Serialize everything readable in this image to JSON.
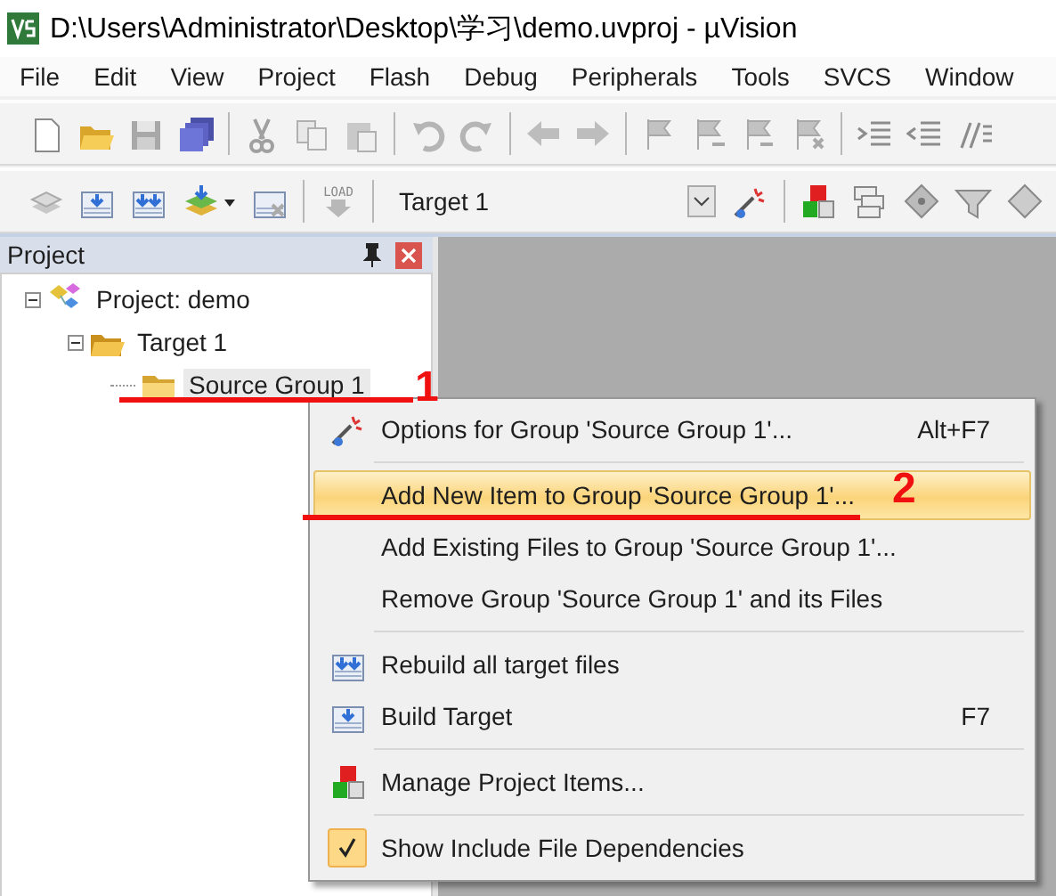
{
  "window": {
    "title": "D:\\Users\\Administrator\\Desktop\\学习\\demo.uvproj - µVision"
  },
  "menu_bar": [
    "File",
    "Edit",
    "View",
    "Project",
    "Flash",
    "Debug",
    "Peripherals",
    "Tools",
    "SVCS",
    "Window"
  ],
  "build_toolbar": {
    "load_label": "LOAD",
    "target": "Target 1"
  },
  "project_panel": {
    "title": "Project",
    "tree": [
      {
        "label": "Project: demo",
        "expanded": true,
        "selected": false,
        "children": [
          {
            "label": "Target 1",
            "expanded": true,
            "selected": false,
            "children": [
              {
                "label": "Source Group 1",
                "selected": true
              }
            ]
          }
        ]
      }
    ]
  },
  "context_menu": [
    {
      "kind": "item",
      "label": "Options for Group 'Source Group 1'...",
      "shortcut": "Alt+F7",
      "selected": false,
      "checked": false
    },
    {
      "kind": "separator"
    },
    {
      "kind": "item",
      "label": "Add New  Item to Group 'Source Group 1'...",
      "selected": true,
      "checked": false
    },
    {
      "kind": "item",
      "label": "Add Existing Files to Group 'Source Group 1'...",
      "selected": false,
      "checked": false
    },
    {
      "kind": "item",
      "label": "Remove Group 'Source Group 1' and its Files",
      "selected": false,
      "checked": false
    },
    {
      "kind": "separator"
    },
    {
      "kind": "item",
      "label": "Rebuild all target files",
      "selected": false,
      "checked": false
    },
    {
      "kind": "item",
      "label": "Build Target",
      "shortcut": "F7",
      "selected": false,
      "checked": false
    },
    {
      "kind": "separator"
    },
    {
      "kind": "item",
      "label": "Manage Project Items...",
      "selected": false,
      "checked": false
    },
    {
      "kind": "separator"
    },
    {
      "kind": "item",
      "label": "Show Include File Dependencies",
      "selected": false,
      "checked": true
    }
  ],
  "annotations": [
    {
      "label": "1"
    },
    {
      "label": "2"
    }
  ]
}
